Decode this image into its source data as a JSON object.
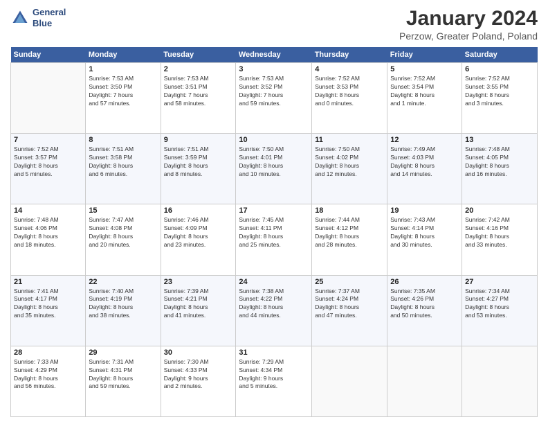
{
  "logo": {
    "line1": "General",
    "line2": "Blue"
  },
  "title": "January 2024",
  "subtitle": "Perzow, Greater Poland, Poland",
  "days_header": [
    "Sunday",
    "Monday",
    "Tuesday",
    "Wednesday",
    "Thursday",
    "Friday",
    "Saturday"
  ],
  "weeks": [
    [
      {
        "day": "",
        "info": ""
      },
      {
        "day": "1",
        "info": "Sunrise: 7:53 AM\nSunset: 3:50 PM\nDaylight: 7 hours\nand 57 minutes."
      },
      {
        "day": "2",
        "info": "Sunrise: 7:53 AM\nSunset: 3:51 PM\nDaylight: 7 hours\nand 58 minutes."
      },
      {
        "day": "3",
        "info": "Sunrise: 7:53 AM\nSunset: 3:52 PM\nDaylight: 7 hours\nand 59 minutes."
      },
      {
        "day": "4",
        "info": "Sunrise: 7:52 AM\nSunset: 3:53 PM\nDaylight: 8 hours\nand 0 minutes."
      },
      {
        "day": "5",
        "info": "Sunrise: 7:52 AM\nSunset: 3:54 PM\nDaylight: 8 hours\nand 1 minute."
      },
      {
        "day": "6",
        "info": "Sunrise: 7:52 AM\nSunset: 3:55 PM\nDaylight: 8 hours\nand 3 minutes."
      }
    ],
    [
      {
        "day": "7",
        "info": "Sunrise: 7:52 AM\nSunset: 3:57 PM\nDaylight: 8 hours\nand 5 minutes."
      },
      {
        "day": "8",
        "info": "Sunrise: 7:51 AM\nSunset: 3:58 PM\nDaylight: 8 hours\nand 6 minutes."
      },
      {
        "day": "9",
        "info": "Sunrise: 7:51 AM\nSunset: 3:59 PM\nDaylight: 8 hours\nand 8 minutes."
      },
      {
        "day": "10",
        "info": "Sunrise: 7:50 AM\nSunset: 4:01 PM\nDaylight: 8 hours\nand 10 minutes."
      },
      {
        "day": "11",
        "info": "Sunrise: 7:50 AM\nSunset: 4:02 PM\nDaylight: 8 hours\nand 12 minutes."
      },
      {
        "day": "12",
        "info": "Sunrise: 7:49 AM\nSunset: 4:03 PM\nDaylight: 8 hours\nand 14 minutes."
      },
      {
        "day": "13",
        "info": "Sunrise: 7:48 AM\nSunset: 4:05 PM\nDaylight: 8 hours\nand 16 minutes."
      }
    ],
    [
      {
        "day": "14",
        "info": "Sunrise: 7:48 AM\nSunset: 4:06 PM\nDaylight: 8 hours\nand 18 minutes."
      },
      {
        "day": "15",
        "info": "Sunrise: 7:47 AM\nSunset: 4:08 PM\nDaylight: 8 hours\nand 20 minutes."
      },
      {
        "day": "16",
        "info": "Sunrise: 7:46 AM\nSunset: 4:09 PM\nDaylight: 8 hours\nand 23 minutes."
      },
      {
        "day": "17",
        "info": "Sunrise: 7:45 AM\nSunset: 4:11 PM\nDaylight: 8 hours\nand 25 minutes."
      },
      {
        "day": "18",
        "info": "Sunrise: 7:44 AM\nSunset: 4:12 PM\nDaylight: 8 hours\nand 28 minutes."
      },
      {
        "day": "19",
        "info": "Sunrise: 7:43 AM\nSunset: 4:14 PM\nDaylight: 8 hours\nand 30 minutes."
      },
      {
        "day": "20",
        "info": "Sunrise: 7:42 AM\nSunset: 4:16 PM\nDaylight: 8 hours\nand 33 minutes."
      }
    ],
    [
      {
        "day": "21",
        "info": "Sunrise: 7:41 AM\nSunset: 4:17 PM\nDaylight: 8 hours\nand 35 minutes."
      },
      {
        "day": "22",
        "info": "Sunrise: 7:40 AM\nSunset: 4:19 PM\nDaylight: 8 hours\nand 38 minutes."
      },
      {
        "day": "23",
        "info": "Sunrise: 7:39 AM\nSunset: 4:21 PM\nDaylight: 8 hours\nand 41 minutes."
      },
      {
        "day": "24",
        "info": "Sunrise: 7:38 AM\nSunset: 4:22 PM\nDaylight: 8 hours\nand 44 minutes."
      },
      {
        "day": "25",
        "info": "Sunrise: 7:37 AM\nSunset: 4:24 PM\nDaylight: 8 hours\nand 47 minutes."
      },
      {
        "day": "26",
        "info": "Sunrise: 7:35 AM\nSunset: 4:26 PM\nDaylight: 8 hours\nand 50 minutes."
      },
      {
        "day": "27",
        "info": "Sunrise: 7:34 AM\nSunset: 4:27 PM\nDaylight: 8 hours\nand 53 minutes."
      }
    ],
    [
      {
        "day": "28",
        "info": "Sunrise: 7:33 AM\nSunset: 4:29 PM\nDaylight: 8 hours\nand 56 minutes."
      },
      {
        "day": "29",
        "info": "Sunrise: 7:31 AM\nSunset: 4:31 PM\nDaylight: 8 hours\nand 59 minutes."
      },
      {
        "day": "30",
        "info": "Sunrise: 7:30 AM\nSunset: 4:33 PM\nDaylight: 9 hours\nand 2 minutes."
      },
      {
        "day": "31",
        "info": "Sunrise: 7:29 AM\nSunset: 4:34 PM\nDaylight: 9 hours\nand 5 minutes."
      },
      {
        "day": "",
        "info": ""
      },
      {
        "day": "",
        "info": ""
      },
      {
        "day": "",
        "info": ""
      }
    ]
  ]
}
